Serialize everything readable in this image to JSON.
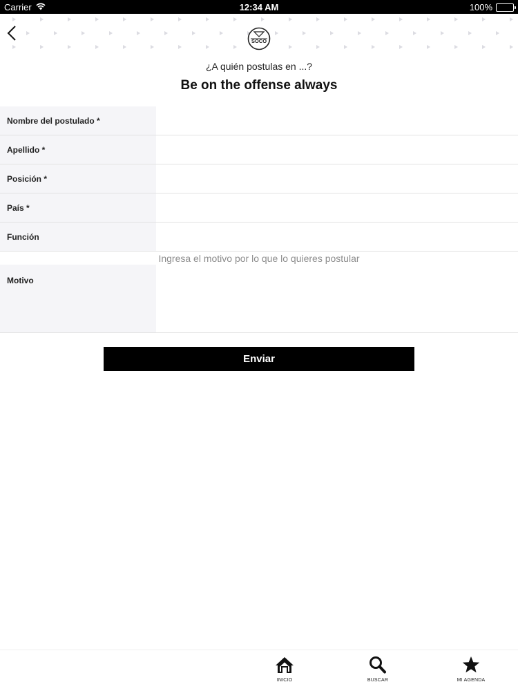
{
  "status_bar": {
    "carrier": "Carrier",
    "time": "12:34 AM",
    "battery": "100%",
    "battery_level": 1.0
  },
  "header": {
    "logo_text": "SOCO",
    "subtitle": "¿A quién postulas en ...?",
    "title": "Be on the offense always"
  },
  "form": {
    "fields": [
      {
        "label": "Nombre del postulado *",
        "value": ""
      },
      {
        "label": "Apellido *",
        "value": ""
      },
      {
        "label": "Posición *",
        "value": ""
      },
      {
        "label": "País *",
        "value": ""
      },
      {
        "label": "Función",
        "value": ""
      }
    ],
    "motivo": {
      "label": "Motivo",
      "hint": "Ingresa el motivo por lo que lo quieres postular",
      "value": ""
    },
    "submit_label": "Enviar"
  },
  "tab_bar": {
    "tabs": [
      {
        "label": "INICIO",
        "icon": "home-icon"
      },
      {
        "label": "BUSCAR",
        "icon": "search-icon"
      },
      {
        "label": "MI AGENDA",
        "icon": "star-icon"
      }
    ]
  },
  "colors": {
    "label_cell_bg": "#f5f5f8",
    "button_bg": "#000000",
    "battery_green": "#35c759",
    "hint_gray": "#8c8c8c"
  }
}
